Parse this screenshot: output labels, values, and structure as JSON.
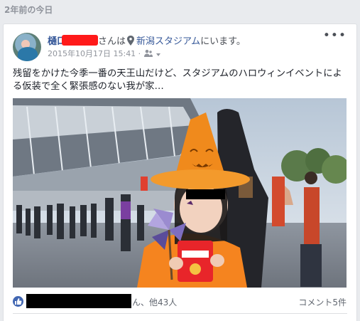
{
  "memory": {
    "header": "2年前の今日"
  },
  "post": {
    "author_name": "樋口",
    "author_suffix": "さんは",
    "location": "新潟スタジアム",
    "at_suffix": "にいます。",
    "timestamp": "2015年10月17日 15:41 ·",
    "more_label": "•••",
    "text": "残留をかけた今季一番の天王山だけど、スタジアムのハロウィンイベントによる仮装で全く緊張感のない我が家…",
    "privacy_icon": "friends-icon",
    "location_icon": "map-pin-icon"
  },
  "footer": {
    "likes_suffix": "ん、他43人",
    "comments": "コメント5件"
  },
  "colors": {
    "link": "#365899",
    "like": "#4267b2",
    "pumpkin_orange": "#f5841f"
  }
}
